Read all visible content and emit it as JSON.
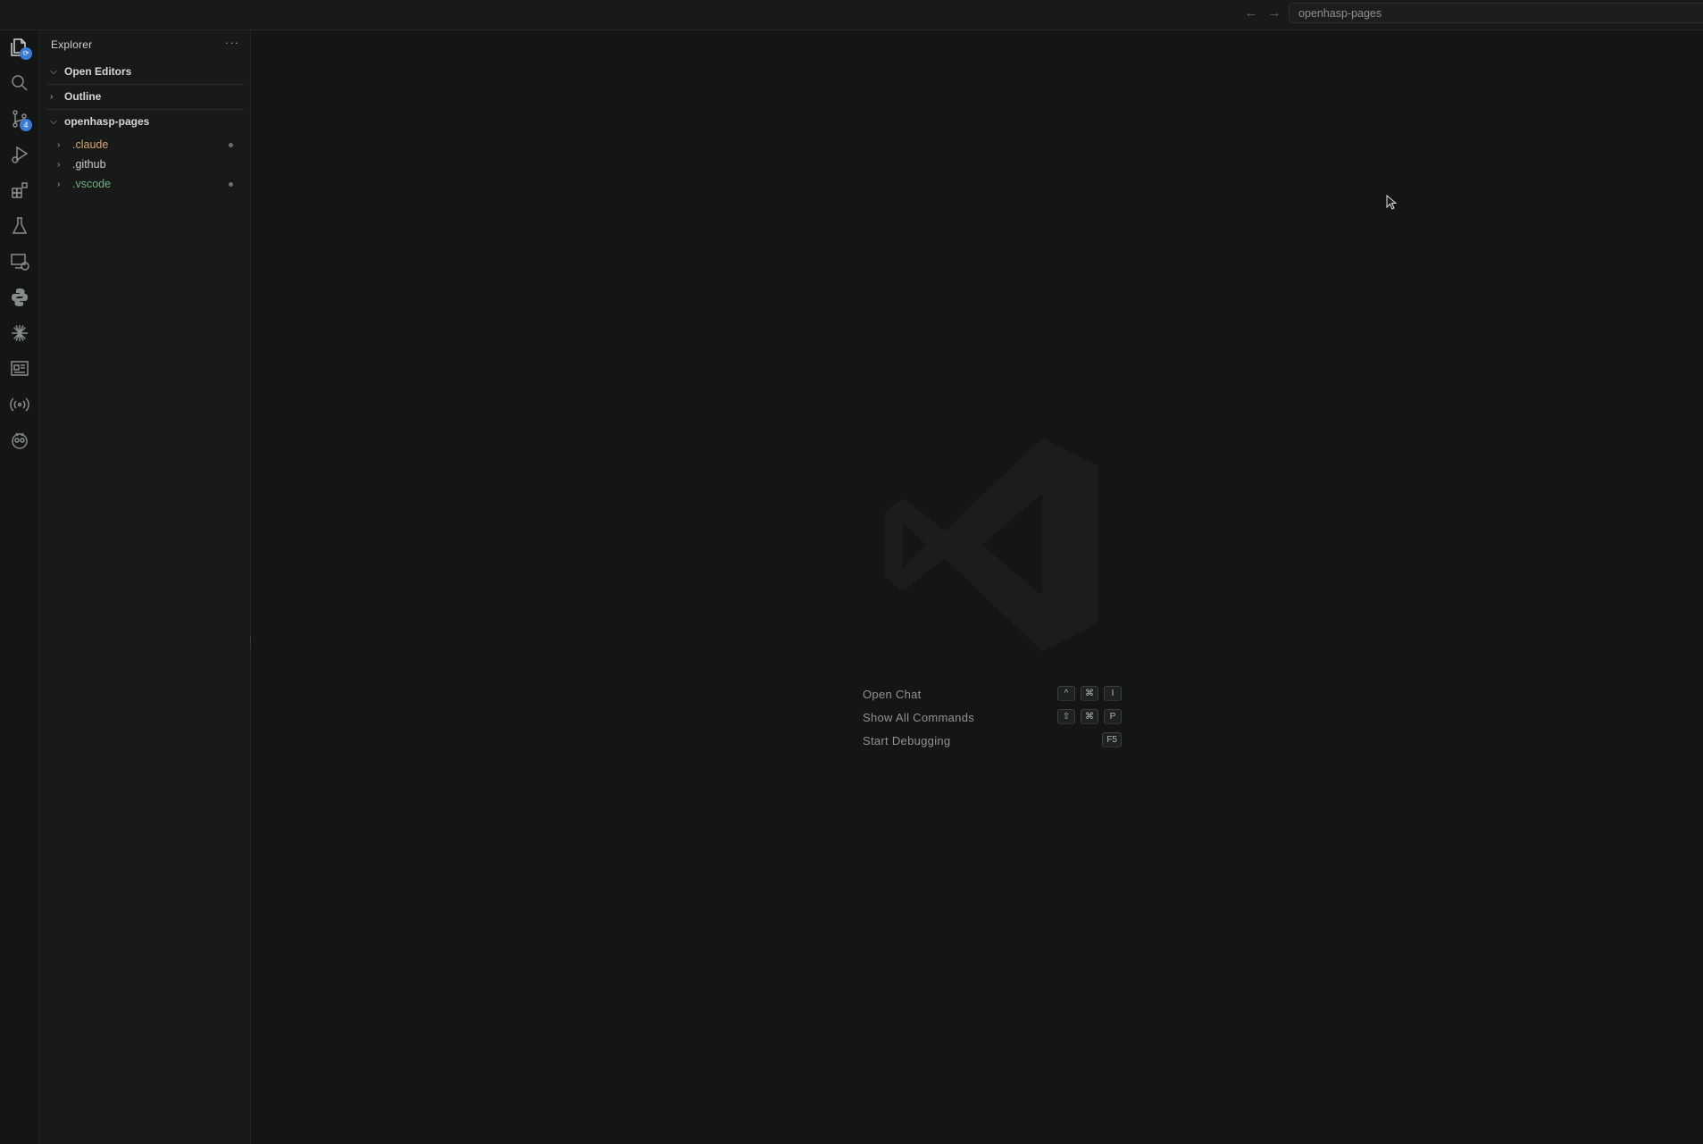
{
  "titlebar": {
    "back_label": "←",
    "forward_label": "→",
    "search_text": "openhasp-pages"
  },
  "activity_bar": {
    "items": [
      {
        "icon": "explorer-icon",
        "active": true
      },
      {
        "icon": "search-icon"
      },
      {
        "icon": "source-control-icon",
        "badge": "4"
      },
      {
        "icon": "run-debug-icon"
      },
      {
        "icon": "extensions-icon"
      },
      {
        "icon": "testing-icon"
      },
      {
        "icon": "remote-explorer-icon"
      },
      {
        "icon": "python-icon"
      },
      {
        "icon": "claude-icon"
      },
      {
        "icon": "outline-panel-icon"
      },
      {
        "icon": "broadcast-icon"
      },
      {
        "icon": "platformio-icon"
      }
    ]
  },
  "sidebar": {
    "title": "Explorer",
    "more_label": "···",
    "sections": {
      "open_editors": "Open Editors",
      "outline": "Outline",
      "workspace": "openhasp-pages"
    },
    "tree": [
      {
        "name": ".claude",
        "color": "#d9a66a",
        "modified": true
      },
      {
        "name": ".github",
        "color": "#cccccc",
        "modified": false
      },
      {
        "name": ".vscode",
        "color": "#6fae7e",
        "modified": true
      }
    ]
  },
  "editor": {
    "shortcuts": [
      {
        "label": "Open Chat",
        "keys": [
          "^",
          "⌘",
          "I"
        ]
      },
      {
        "label": "Show All Commands",
        "keys": [
          "⇧",
          "⌘",
          "P"
        ]
      },
      {
        "label": "Start Debugging",
        "keys": [
          "F5"
        ]
      }
    ]
  },
  "colors": {
    "background": "#141616",
    "sidebar": "#181a1a",
    "badge": "#3a7bd5"
  }
}
